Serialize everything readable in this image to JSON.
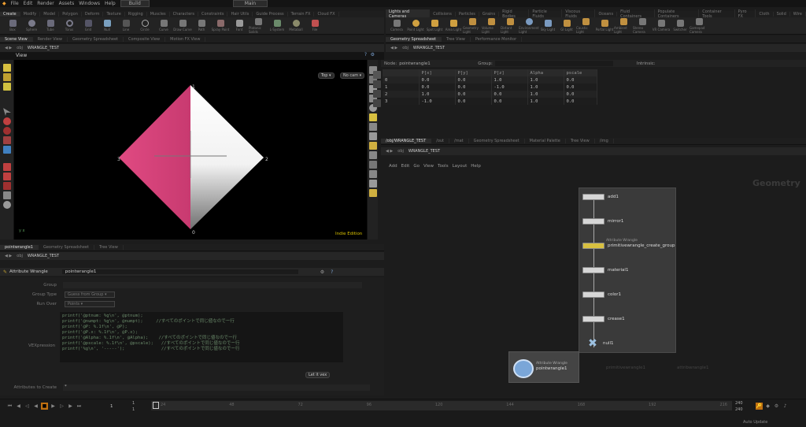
{
  "menubar": {
    "items": [
      "File",
      "Edit",
      "Render",
      "Assets",
      "Windows",
      "Help"
    ],
    "desktop": "Build",
    "workspace": "Main"
  },
  "shelf_tabs": [
    "Create",
    "Modify",
    "Model",
    "Polygon",
    "Deform",
    "Texture",
    "Rigging",
    "Muscles",
    "Characters",
    "Constraints",
    "Hair Utils",
    "Guide Process",
    "Terrain FX",
    "Cloud FX",
    "Volume"
  ],
  "shelf_tools": [
    "Box",
    "Sphere",
    "Tube",
    "Torus",
    "Grid",
    "Null",
    "Line",
    "Circle",
    "Curve",
    "Draw Curve",
    "Path",
    "Spray Paint",
    "Font",
    "Platonic Solids",
    "L-System",
    "Metaball",
    "File"
  ],
  "light_tabs": [
    "Lights and Cameras",
    "Collisions",
    "Particles",
    "Grains",
    "Rigid Bodies",
    "Particle Fluids",
    "Viscous Fluids",
    "Oceans",
    "Fluid Containers",
    "Populate Containers",
    "Container Tools",
    "Pyro FX",
    "Cloth",
    "Solid",
    "Wire",
    "Crowds",
    "Drive Simula"
  ],
  "light_tools": [
    "Camera",
    "Point Light",
    "Spot Light",
    "Area Light",
    "Geometry Light",
    "Volume Light",
    "Distant Light",
    "Environment Light",
    "Sky Light",
    "GI Light",
    "Caustic Light",
    "Portal Light",
    "Ambient Light",
    "Stereo Camera",
    "VR Camera",
    "Switcher",
    "Gamepad Camera"
  ],
  "left_pane": {
    "tabs": [
      "Scene View",
      "Render View",
      "Geometry Spreadsheet",
      "Composite View",
      "Motion FX View"
    ],
    "path": "obj",
    "node": "WRANGLE_TEST",
    "view_title": "View",
    "view_dropdown": "Top",
    "cam_dropdown": "No cam",
    "watermark": "Indie Edition",
    "axis_label": "y  x"
  },
  "viewport": {
    "vertex_labels": [
      "0",
      "1",
      "2",
      "3"
    ]
  },
  "params": {
    "tabs": [
      "pointwrangle1",
      "Geometry Spreadsheet",
      "Tree View"
    ],
    "path": "obj",
    "node": "WRANGLE_TEST",
    "type_label": "Attribute Wrangle",
    "node_name": "pointwrangle1",
    "fields": [
      {
        "label": "Group",
        "value": ""
      },
      {
        "label": "Group Type",
        "value": "Guess from Group"
      },
      {
        "label": "Run Over",
        "value": "Points"
      }
    ],
    "vex_label": "VEXpression",
    "code": [
      "printf('@ptnum: %g\\n', @ptnum);",
      "printf('@numpt: %g\\n', @numpt);     //すべてのポイントで同じ値なのでー行",
      "printf('@P: %.1f\\n', @P);",
      "printf('@P.x: %.1f\\n', @P.x);",
      "printf('@Alpha: %.1f\\n', @Alpha);    //すべてのポイントで同じ値なのでー行",
      "printf('@pscale: %.1f\\n', @pscale);   //すべてのポイントで同じ値なのでー行",
      "printf('%g\\n', '-----');              //すべてのポイントで同じ値なのでー行"
    ],
    "bottom_label": "Attributes to Create",
    "bottom_value": "*",
    "button": "Let it vex"
  },
  "spreadsheet": {
    "tabs": [
      "Geometry Spreadsheet",
      "Tree View",
      "Performance Monitor"
    ],
    "path": "obj",
    "node": "WRANGLE_TEST",
    "node_label": "Node:",
    "node_value": "pointwrangle1",
    "group_label": "Group:",
    "intrinsic": "Intrinsic:",
    "columns": [
      "",
      "P[x]",
      "P[y]",
      "P[z]",
      "Alpha",
      "pscale"
    ],
    "rows": [
      [
        "0",
        "0.0",
        "0.0",
        "1.0",
        "1.0",
        "0.0"
      ],
      [
        "1",
        "0.0",
        "0.0",
        "-1.0",
        "1.0",
        "0.0"
      ],
      [
        "2",
        "1.0",
        "0.0",
        "0.0",
        "1.0",
        "0.0"
      ],
      [
        "3",
        "-1.0",
        "0.0",
        "0.0",
        "1.0",
        "0.0"
      ]
    ]
  },
  "network": {
    "tabs": [
      "/obj/WRANGLE_TEST",
      "/out",
      "/mat",
      "Geometry Spreadsheet",
      "Material Palette",
      "Tree View",
      "/img"
    ],
    "path": "obj",
    "node": "WRANGLE_TEST",
    "menu": [
      "Add",
      "Edit",
      "Go",
      "View",
      "Tools",
      "Layout",
      "Help"
    ],
    "context": "Geometry",
    "nodes": [
      {
        "name": "add1",
        "sub": ""
      },
      {
        "name": "mirror1",
        "sub": ""
      },
      {
        "name": "primitivewrangle_create_group",
        "sub": "Attribute Wrangle"
      },
      {
        "name": "material1",
        "sub": ""
      },
      {
        "name": "color1",
        "sub": ""
      },
      {
        "name": "crease1",
        "sub": ""
      },
      {
        "name": "null1",
        "sub": ""
      }
    ],
    "selected": {
      "name": "pointwrangle1",
      "sub": "Attribute Wrangle"
    },
    "ghost": [
      "primitivewrangle1",
      "attribwrangle1"
    ]
  },
  "timeline": {
    "frame": "1",
    "start": "1",
    "end": "240",
    "ticks": [
      "1",
      "24",
      "48",
      "72",
      "96",
      "120",
      "144",
      "168",
      "192",
      "216",
      "240"
    ],
    "range_end": "240",
    "range_end2": "240",
    "auto_update": "Auto Update"
  },
  "colors": {
    "pink": "#d9467f",
    "bg": "#1c1c1c",
    "accent": "#f0a030"
  }
}
